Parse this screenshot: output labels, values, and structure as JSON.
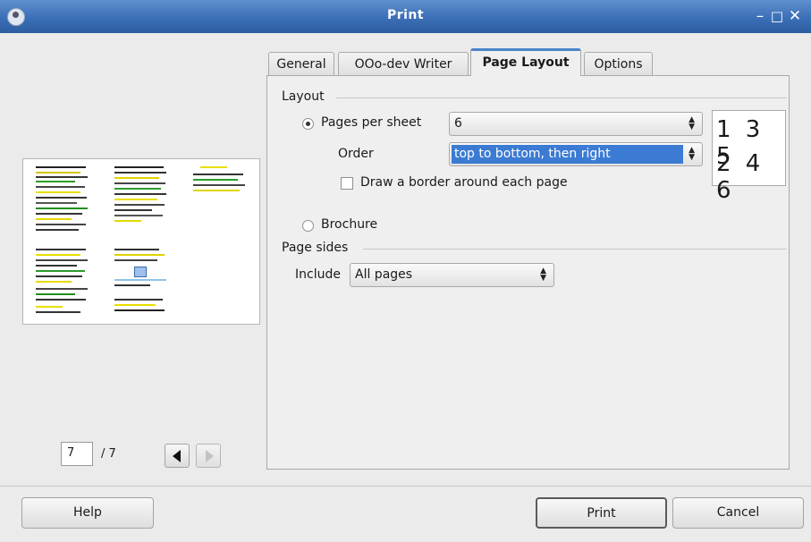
{
  "window": {
    "title": "Print",
    "minimize_glyph": "–",
    "maximize_glyph": "□",
    "close_glyph": "✕"
  },
  "tabs": [
    {
      "label": "General"
    },
    {
      "label": "OOo-dev Writer"
    },
    {
      "label": "Page Layout"
    },
    {
      "label": "Options"
    }
  ],
  "layout": {
    "section_label": "Layout",
    "pages_per_sheet_label": "Pages per sheet",
    "pages_per_sheet_value": "6",
    "order_label": "Order",
    "order_value": "top to bottom, then right",
    "border_checkbox_label": "Draw a border around each page",
    "border_checked": false,
    "brochure_label": "Brochure",
    "order_preview_row1": "1 3 5",
    "order_preview_row2": "2 4 6"
  },
  "page_sides": {
    "section_label": "Page sides",
    "include_label": "Include",
    "include_value": "All pages"
  },
  "navigation": {
    "current_page": "7",
    "total_pages": "/ 7"
  },
  "buttons": {
    "help": "Help",
    "print": "Print",
    "cancel": "Cancel"
  },
  "colors": {
    "title_bar": "#3b6fb7",
    "selection": "#3b7bd3",
    "active_tab_accent": "#4a84c9"
  }
}
